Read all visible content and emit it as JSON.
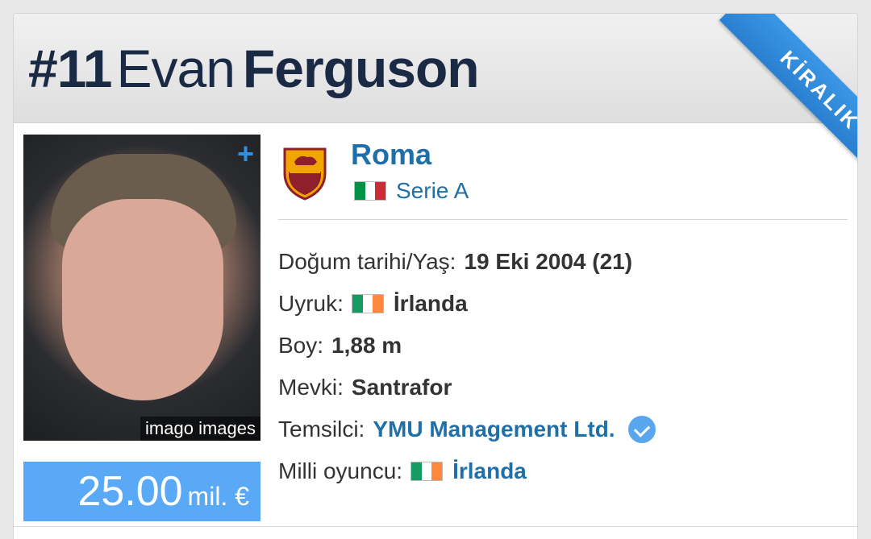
{
  "player": {
    "number": "#11",
    "first_name": "Evan",
    "last_name": "Ferguson",
    "status_badge": "KİRALIK",
    "photo_credit": "imago images",
    "photo_plus": "+",
    "market_value": "25.00",
    "market_value_unit": "mil. €"
  },
  "club": {
    "name": "Roma",
    "league": "Serie A",
    "league_flag_colors": [
      "#009246",
      "#ffffff",
      "#ce2b37"
    ]
  },
  "details": {
    "dob_label": "Doğum tarihi/Yaş:",
    "dob_value": "19 Eki 2004 (21)",
    "nationality_label": "Uyruk:",
    "nationality_value": "İrlanda",
    "height_label": "Boy:",
    "height_value": "1,88 m",
    "position_label": "Mevki:",
    "position_value": "Santrafor",
    "agent_label": "Temsilci:",
    "agent_value": "YMU Management Ltd.",
    "national_label": "Milli oyuncu:",
    "national_value": "İrlanda",
    "ireland_flag_colors": [
      "#169b62",
      "#ffffff",
      "#ff883e"
    ]
  },
  "colors": {
    "accent_blue": "#1f6fa8",
    "ribbon": "#2f8ae0",
    "value_box": "#59a9f7",
    "title_text": "#1a2a44"
  }
}
